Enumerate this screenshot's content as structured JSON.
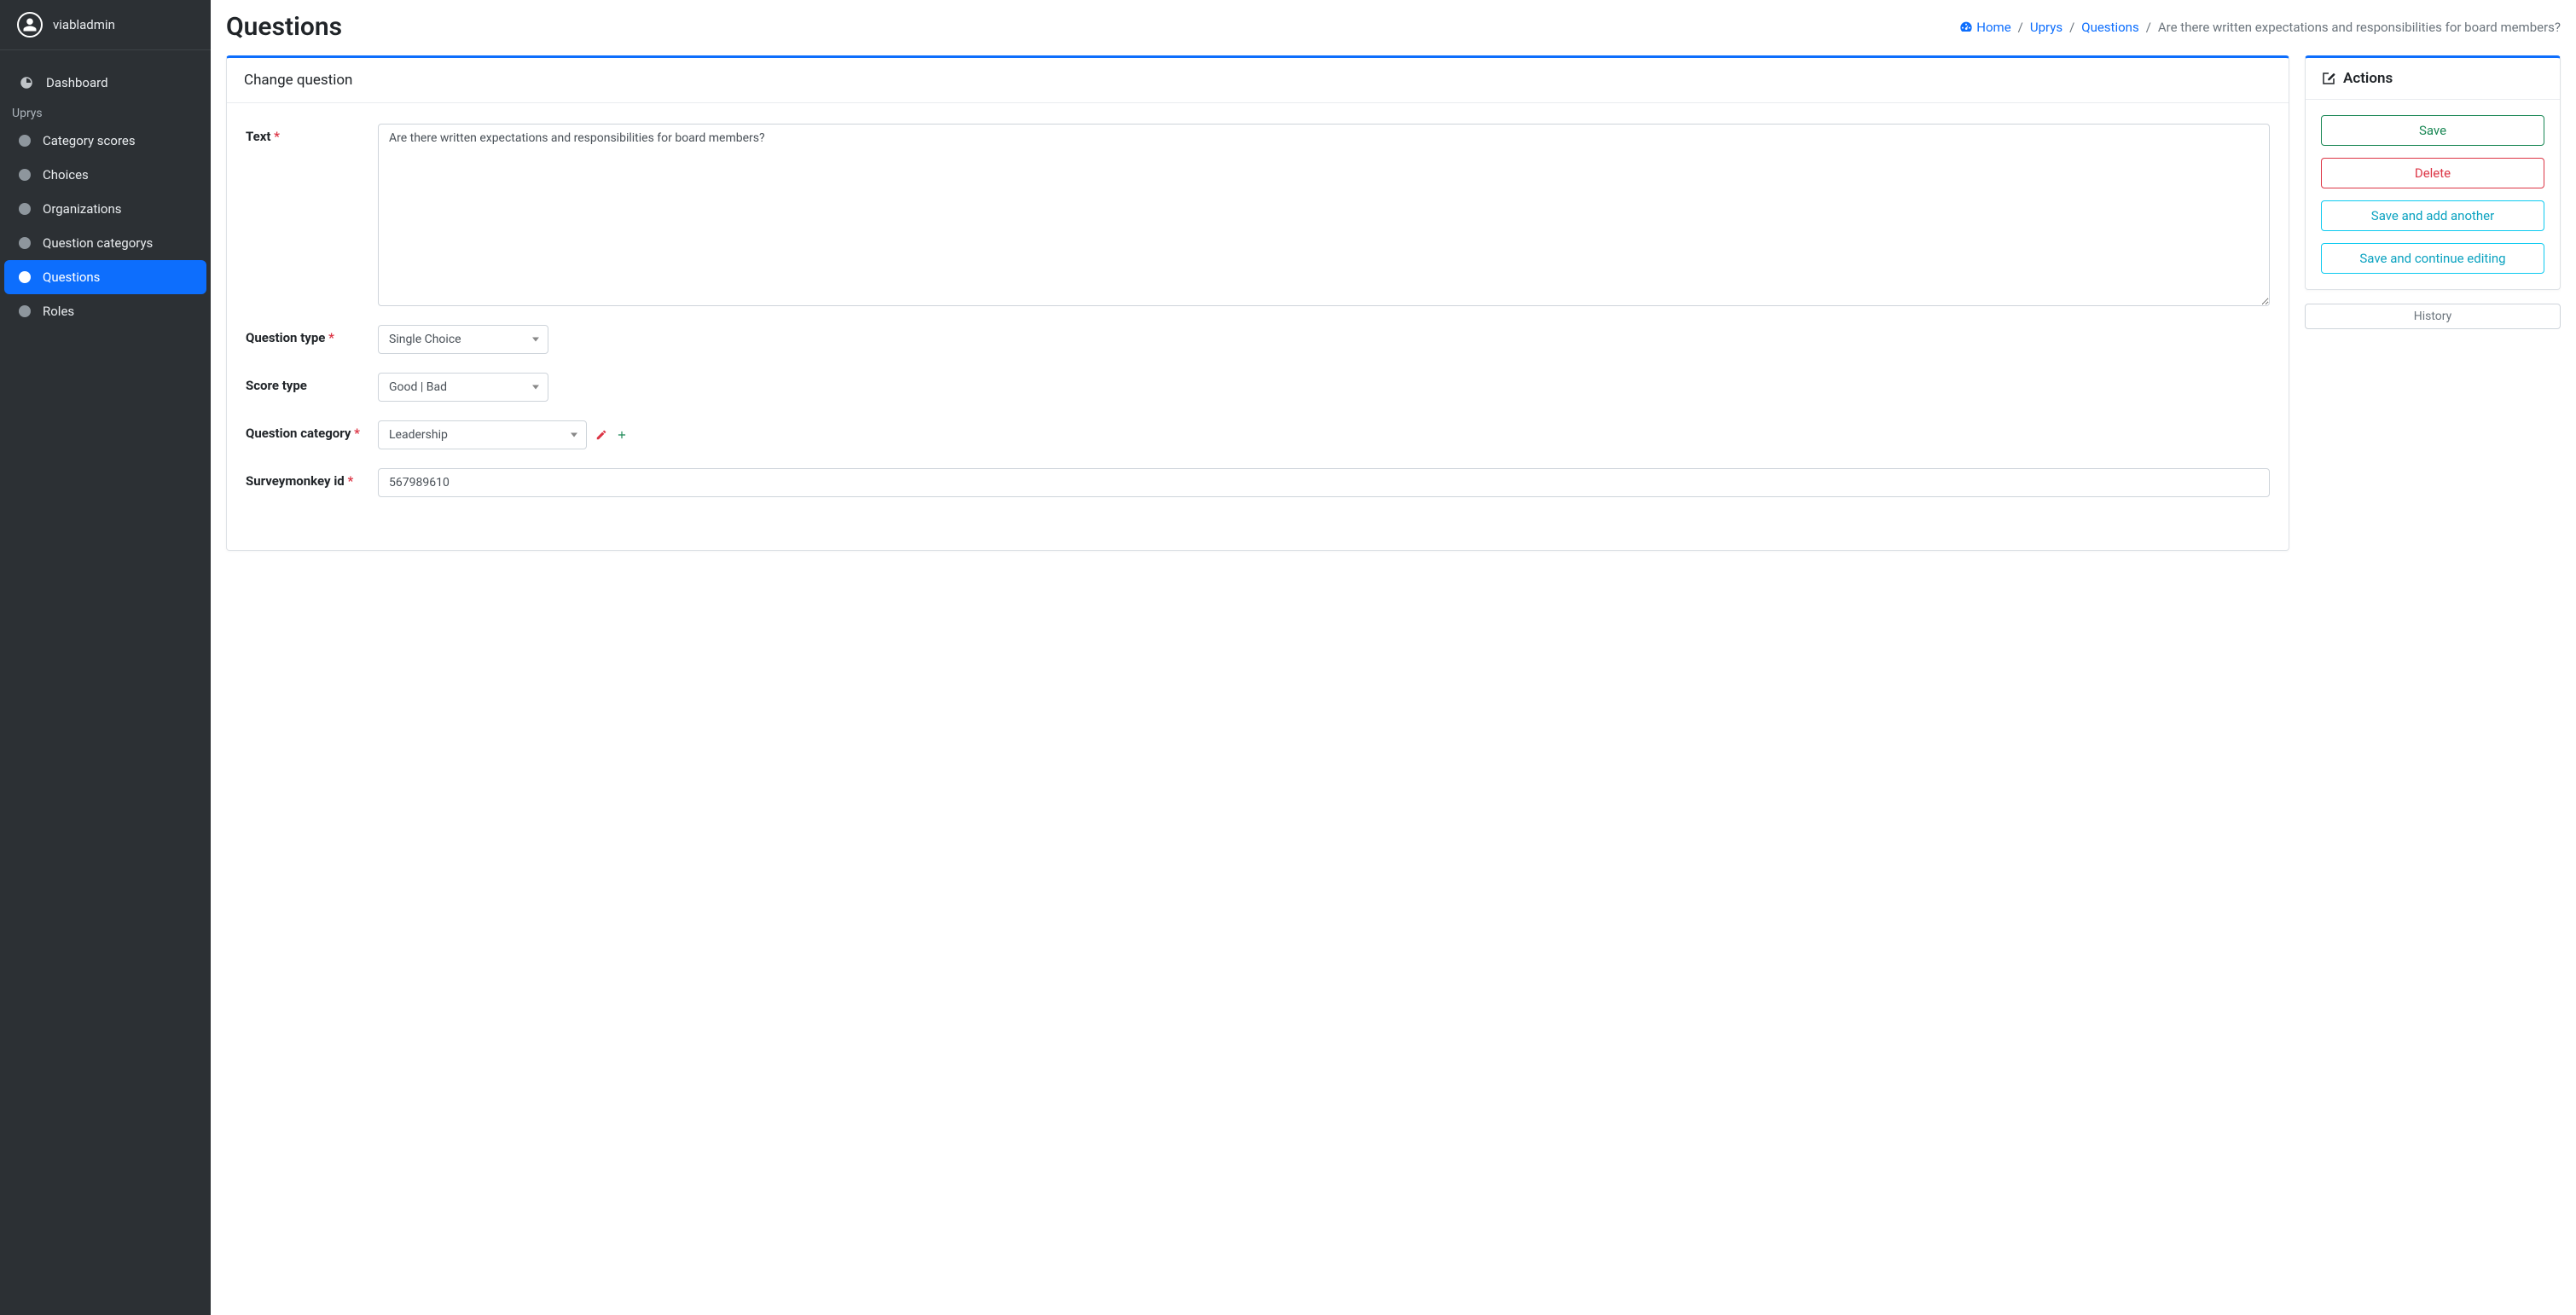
{
  "user": {
    "name": "viabladmin"
  },
  "sidebar": {
    "dashboard_label": "Dashboard",
    "section_label": "Uprys",
    "items": [
      {
        "label": "Category scores"
      },
      {
        "label": "Choices"
      },
      {
        "label": "Organizations"
      },
      {
        "label": "Question categorys"
      },
      {
        "label": "Questions"
      },
      {
        "label": "Roles"
      }
    ]
  },
  "page": {
    "title": "Questions",
    "breadcrumb": {
      "home": "Home",
      "app": "Uprys",
      "model": "Questions",
      "current": "Are there written expectations and responsibilities for board members?"
    }
  },
  "form": {
    "header": "Change question",
    "fields": {
      "text": {
        "label": "Text",
        "value": "Are there written expectations and responsibilities for board members?"
      },
      "question_type": {
        "label": "Question type",
        "value": "Single Choice"
      },
      "score_type": {
        "label": "Score type",
        "value": "Good | Bad"
      },
      "question_category": {
        "label": "Question category",
        "value": "Leadership"
      },
      "surveymonkey_id": {
        "label": "Surveymonkey id",
        "value": "567989610"
      }
    }
  },
  "actions": {
    "header": "Actions",
    "save": "Save",
    "delete": "Delete",
    "save_add": "Save and add another",
    "save_continue": "Save and continue editing",
    "history": "History"
  }
}
